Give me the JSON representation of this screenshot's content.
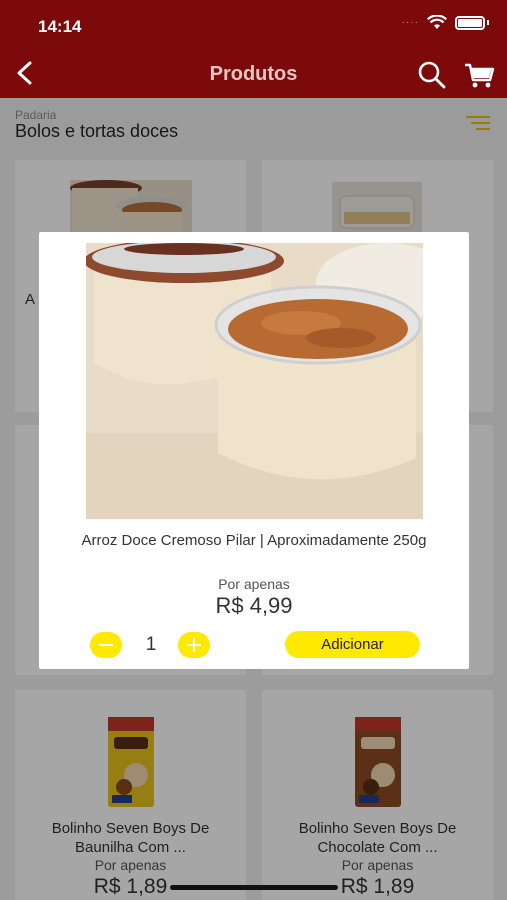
{
  "status_bar": {
    "time": "14:14",
    "signal": "····"
  },
  "header": {
    "title": "Produtos"
  },
  "sub_header": {
    "breadcrumb": "Padaria",
    "category": "Bolos e tortas doces"
  },
  "background_cards": [
    {
      "name": "A"
    },
    {
      "name": ""
    },
    {
      "name": "Bolinho Seven Boys De Baunilha Com ...",
      "label": "Por apenas",
      "price": "R$ 1,89"
    },
    {
      "name": "Bolinho Seven Boys De Chocolate Com ...",
      "label": "Por apenas",
      "price": "R$ 1,89"
    }
  ],
  "modal": {
    "product_name": "Arroz Doce Cremoso Pilar | Aproximadamente 250g",
    "price_label": "Por apenas",
    "price": "R$ 4,99",
    "quantity": "1",
    "add_label": "Adicionar"
  },
  "colors": {
    "header": "#7c0a0a",
    "accent": "#ffe900"
  }
}
